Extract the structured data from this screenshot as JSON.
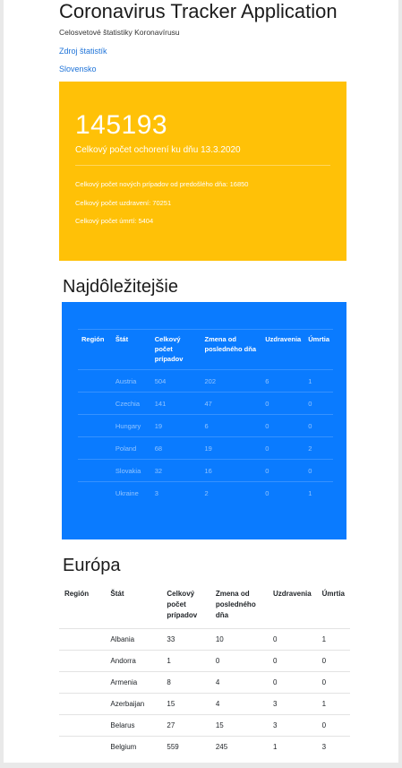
{
  "header": {
    "title": "Coronavirus Tracker Application",
    "subtitle": "Celosvetové štatistiky Koronavírusu",
    "links": [
      "Zdroj štatistík",
      "Slovensko"
    ]
  },
  "summary": {
    "total": "145193",
    "caption": "Celkový počet ochorení ku dňu 13.3.2020",
    "new_cases": "Celkový počet nových prípadov od predošlého dňa: 16850",
    "recovered": "Celkový počet uzdravení: 70251",
    "deaths": "Celkový počet úmrtí: 5404"
  },
  "important": {
    "title": "Najdôležitejšie",
    "columns": [
      "Región",
      "Štát",
      "Celkový počet prípadov",
      "Zmena od posledného dňa",
      "Uzdravenia",
      "Úmrtia"
    ],
    "rows": [
      {
        "region": "",
        "country": "Austria",
        "total": "504",
        "change": "202",
        "recovered": "6",
        "deaths": "1"
      },
      {
        "region": "",
        "country": "Czechia",
        "total": "141",
        "change": "47",
        "recovered": "0",
        "deaths": "0"
      },
      {
        "region": "",
        "country": "Hungary",
        "total": "19",
        "change": "6",
        "recovered": "0",
        "deaths": "0"
      },
      {
        "region": "",
        "country": "Poland",
        "total": "68",
        "change": "19",
        "recovered": "0",
        "deaths": "2"
      },
      {
        "region": "",
        "country": "Slovakia",
        "total": "32",
        "change": "16",
        "recovered": "0",
        "deaths": "0"
      },
      {
        "region": "",
        "country": "Ukraine",
        "total": "3",
        "change": "2",
        "recovered": "0",
        "deaths": "1"
      }
    ]
  },
  "europe": {
    "title": "Európa",
    "columns": [
      "Región",
      "Štát",
      "Celkový počet prípadov",
      "Zmena od posledného dňa",
      "Uzdravenia",
      "Úmrtia"
    ],
    "rows": [
      {
        "region": "",
        "country": "Albania",
        "total": "33",
        "change": "10",
        "recovered": "0",
        "deaths": "1"
      },
      {
        "region": "",
        "country": "Andorra",
        "total": "1",
        "change": "0",
        "recovered": "0",
        "deaths": "0"
      },
      {
        "region": "",
        "country": "Armenia",
        "total": "8",
        "change": "4",
        "recovered": "0",
        "deaths": "0"
      },
      {
        "region": "",
        "country": "Azerbaijan",
        "total": "15",
        "change": "4",
        "recovered": "3",
        "deaths": "1"
      },
      {
        "region": "",
        "country": "Belarus",
        "total": "27",
        "change": "15",
        "recovered": "3",
        "deaths": "0"
      },
      {
        "region": "",
        "country": "Belgium",
        "total": "559",
        "change": "245",
        "recovered": "1",
        "deaths": "3"
      }
    ]
  },
  "colors": {
    "yellow_card": "#ffc107",
    "blue_card": "#0a7bff",
    "link": "#1e73d8"
  }
}
